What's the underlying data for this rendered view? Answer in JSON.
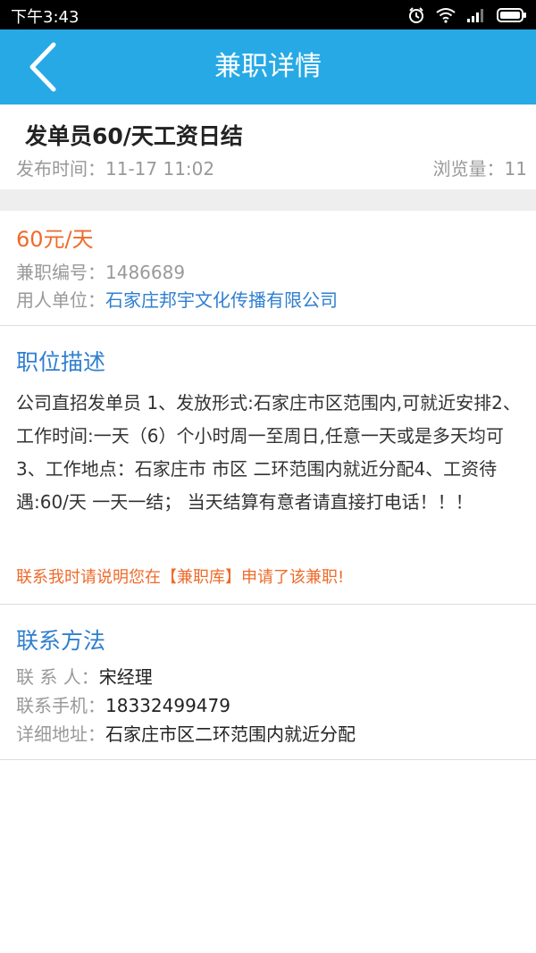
{
  "status_bar": {
    "time": "下午3:43",
    "icons": [
      "alarm-icon",
      "wifi-icon",
      "signal-icon",
      "battery-icon"
    ]
  },
  "header": {
    "title": "兼职详情",
    "back_icon": "back-chevron-icon",
    "background_color": "#27a9e6"
  },
  "job": {
    "title": "发单员60/天工资日结",
    "publish_label": "发布时间：",
    "publish_time": "11-17 11:02",
    "views_label": "浏览量：",
    "views": "11"
  },
  "info": {
    "salary": "60元/天",
    "id_label": "兼职编号：",
    "id_value": "1486689",
    "employer_label": "用人单位：",
    "employer_value": "石家庄邦宇文化传播有限公司"
  },
  "description": {
    "heading": "职位描述",
    "text": "公司直招发单员 1、发放形式:石家庄市区范围内,可就近安排2、工作时间:一天（6）个小时周一至周日,任意一天或是多天均可3、工作地点：石家庄市 市区 二环范围内就近分配4、工资待遇:60/天 一天一结； 当天结算有意者请直接打电话！！！",
    "notice": "联系我时请说明您在【兼职库】申请了该兼职!"
  },
  "contact": {
    "heading": "联系方法",
    "person_label": "联 系 人：",
    "person_value": "宋经理",
    "phone_label": "联系手机：",
    "phone_value": "18332499479",
    "address_label": "详细地址：",
    "address_value": "石家庄市区二环范围内就近分配"
  },
  "colors": {
    "accent_blue": "#2f7fcf",
    "highlight_orange": "#ef6a2a",
    "muted_gray": "#999999"
  }
}
